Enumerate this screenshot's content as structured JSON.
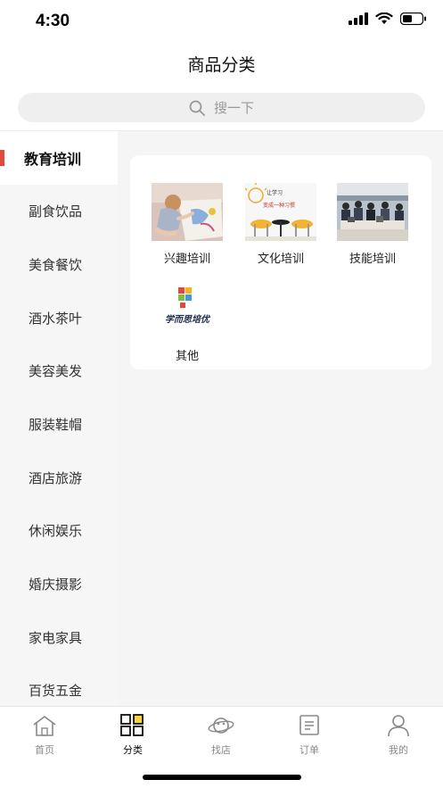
{
  "status": {
    "time": "4:30"
  },
  "nav": {
    "title": "商品分类"
  },
  "search": {
    "placeholder": "搜一下"
  },
  "sidebar": {
    "items": [
      {
        "label": "教育培训",
        "active": true
      },
      {
        "label": "副食饮品"
      },
      {
        "label": "美食餐饮"
      },
      {
        "label": "酒水茶叶"
      },
      {
        "label": "美容美发"
      },
      {
        "label": "服装鞋帽"
      },
      {
        "label": "酒店旅游"
      },
      {
        "label": "休闲娱乐"
      },
      {
        "label": "婚庆摄影"
      },
      {
        "label": "家电家具"
      },
      {
        "label": "百货五金"
      }
    ]
  },
  "categories": [
    {
      "label": "兴趣培训",
      "icon": "child-drawing-photo"
    },
    {
      "label": "文化培训",
      "icon": "study-banner-photo",
      "image_text": [
        "让学习",
        "变成一种习惯"
      ]
    },
    {
      "label": "技能培训",
      "icon": "workshop-photo"
    },
    {
      "label": "其他",
      "icon": "xueersi-logo",
      "image_text": "学而思培优"
    }
  ],
  "tabbar": {
    "items": [
      {
        "label": "首页",
        "icon": "home-icon"
      },
      {
        "label": "分类",
        "icon": "category-icon",
        "active": true
      },
      {
        "label": "找店",
        "icon": "planet-icon"
      },
      {
        "label": "订单",
        "icon": "order-icon"
      },
      {
        "label": "我的",
        "icon": "user-icon"
      }
    ]
  },
  "colors": {
    "accent": "#e04a3a",
    "active_tab": "#111111",
    "inactive_tab": "#888888",
    "logo_yellow": "#f5d53a"
  }
}
